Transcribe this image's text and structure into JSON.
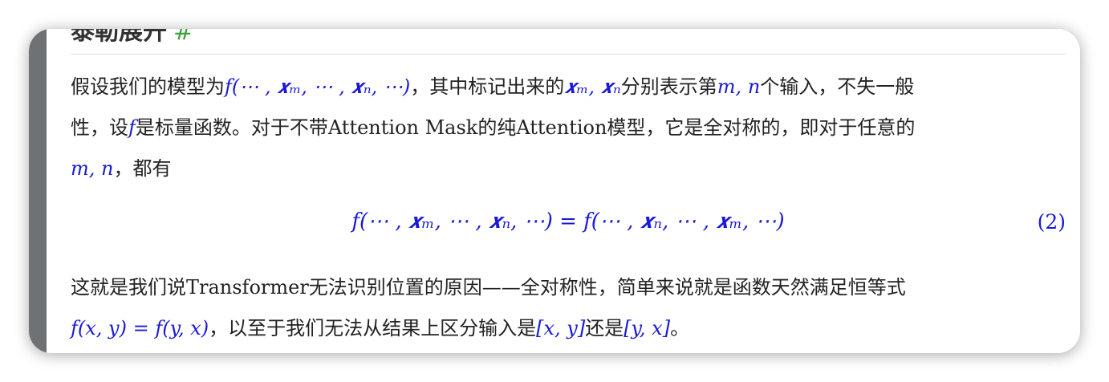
{
  "heading": {
    "partial_title": "泰勒展开",
    "anchor": "#"
  },
  "paragraph1": {
    "line1_prefix": "假设我们的模型为",
    "line1_math1": "f(⋯ , 𝒙ₘ, ⋯ , 𝒙ₙ, ⋯)",
    "line1_mid": "，其中标记出来的",
    "line1_math2": "𝒙ₘ, 𝒙ₙ",
    "line1_mid2": "分别表示第",
    "line1_math3": "m, n",
    "line1_suffix": "个输入，不失一般",
    "line2_prefix": "性，设",
    "line2_math": "f",
    "line2_suffix": "是标量函数。对于不带Attention Mask的纯Attention模型，它是全对称的，即对于任意的",
    "line3_math": "m, n",
    "line3_suffix": "，都有"
  },
  "equation": {
    "text": "f(⋯ , 𝒙ₘ, ⋯ , 𝒙ₙ, ⋯) = f(⋯ , 𝒙ₙ, ⋯ , 𝒙ₘ, ⋯)",
    "number": "(2)"
  },
  "paragraph2": {
    "line1": "这就是我们说Transformer无法识别位置的原因——全对称性，简单来说就是函数天然满足恒等式",
    "line2_math1": "f(x, y) = f(y, x)",
    "line2_mid": "，以至于我们无法从结果上区分输入是",
    "line2_math2": "[x, y]",
    "line2_mid2": "还是",
    "line2_math3": "[y, x]",
    "line2_suffix": "。"
  },
  "colors": {
    "math": "#1a1ad6",
    "sidebar": "#6f7275",
    "anchor": "#3aa13a"
  }
}
